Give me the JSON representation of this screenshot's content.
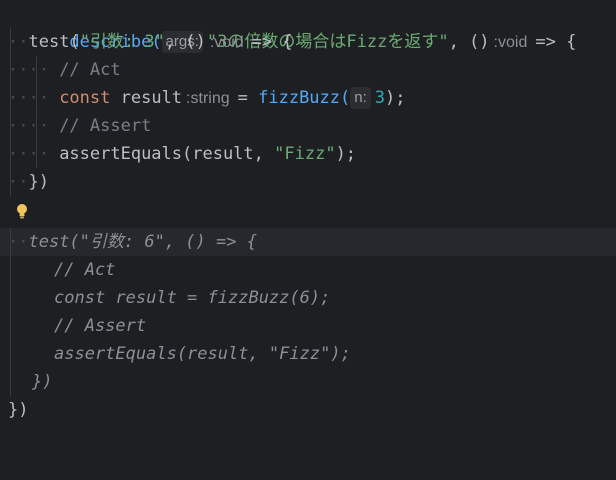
{
  "editor": {
    "lines": [
      {
        "describe": "describe(",
        "hint_args": "args:",
        "title_str": "\"3の倍数の場合はFizzを返す\"",
        "comma": ",",
        "arrow_open": "()",
        "void": ":void",
        "arrow": "=>",
        "brace": "{"
      },
      {
        "test": "test(",
        "str": "\"引数: 3\"",
        "comma": ",",
        "arrow_open": "()",
        "void": ":void",
        "arrow": "=>",
        "brace": "{"
      },
      {
        "comment": "// Act"
      },
      {
        "const": "const",
        "name": "result",
        "type": ":string",
        "eq": "=",
        "call": "fizzBuzz(",
        "hint_n": "n:",
        "num": "3",
        "end": ");"
      },
      {
        "comment": "// Assert"
      },
      {
        "assert": "assertEquals(result,",
        "str": "\"Fizz\"",
        "end": ");"
      },
      {
        "close": "})"
      },
      {
        "test2": "test(\"引数: 6\", () => {"
      },
      {
        "comment2": "// Act"
      },
      {
        "line2": "const result = fizzBuzz(6);"
      },
      {
        "comment3": "// Assert"
      },
      {
        "assert2": "assertEquals(result, \"Fizz\");"
      },
      {
        "close2": "})"
      },
      {
        "close3": "})"
      }
    ],
    "colors": {
      "background": "#1e1f22",
      "function": "#56a8f5",
      "keyword": "#cf8e6d",
      "string": "#6aab73",
      "number": "#2aacb8",
      "comment": "#7a7e85",
      "bulb": "#f2c55c"
    },
    "icons": [
      "lightbulb-icon"
    ]
  }
}
